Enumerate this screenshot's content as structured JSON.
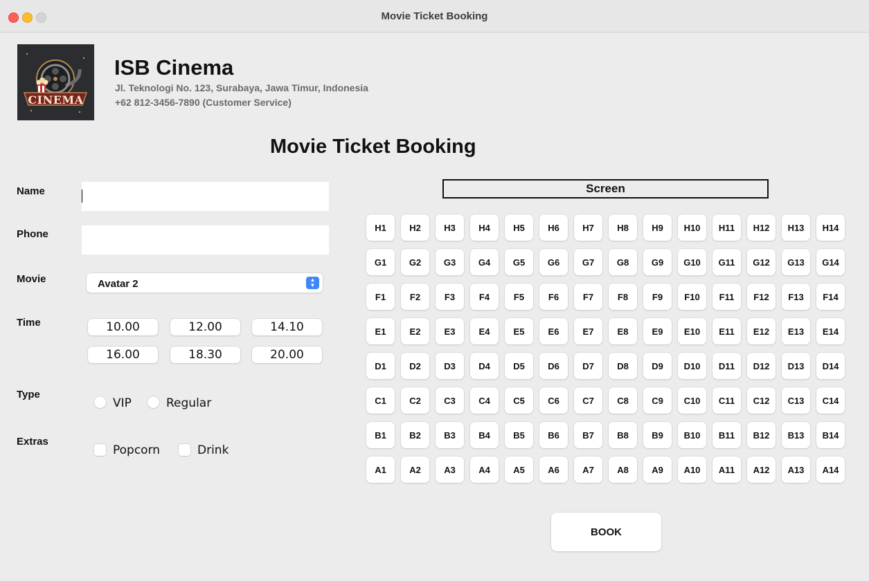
{
  "window": {
    "title": "Movie Ticket Booking"
  },
  "header": {
    "cinema_name": "ISB Cinema",
    "address": "Jl. Teknologi No. 123, Surabaya, Jawa Timur, Indonesia",
    "phone": "+62 812-3456-7890 (Customer Service)",
    "logo_text": "CINEMA"
  },
  "page_title": "Movie Ticket Booking",
  "form": {
    "name_label": "Name",
    "name_value": "",
    "phone_label": "Phone",
    "phone_value": "",
    "movie_label": "Movie",
    "movie_selected": "Avatar 2",
    "time_label": "Time",
    "times": [
      "10.00",
      "12.00",
      "14.10",
      "16.00",
      "18.30",
      "20.00"
    ],
    "type_label": "Type",
    "type_options": [
      "VIP",
      "Regular"
    ],
    "extras_label": "Extras",
    "extras_options": [
      "Popcorn",
      "Drink"
    ]
  },
  "seating": {
    "screen_label": "Screen",
    "rows": [
      "H",
      "G",
      "F",
      "E",
      "D",
      "C",
      "B",
      "A"
    ],
    "seats_per_row": 14
  },
  "book_button": "BOOK",
  "colors": {
    "window_bg": "#ececec",
    "close": "#ff5f57",
    "minimize": "#febc2e",
    "accent": "#3f87f7"
  }
}
